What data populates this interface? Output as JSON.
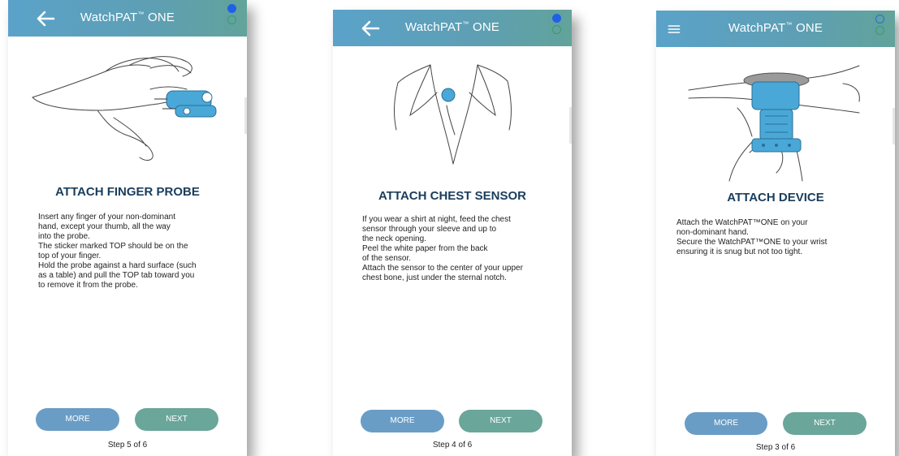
{
  "screens": [
    {
      "app_title": "WatchPAT",
      "app_title_tm": "™",
      "app_title_suffix": "ONE",
      "nav_icon": "back-arrow-icon",
      "heading": "ATTACH FINGER PROBE",
      "lines": [
        "Insert any finger of your non-dominant",
        "hand, except your thumb, all the way",
        "into the probe.",
        "The sticker marked TOP should be on the",
        "top of your finger.",
        "Hold the probe against a hard surface (such",
        "as a table) and pull the TOP tab toward you",
        "to remove it from the probe."
      ],
      "more_label": "MORE",
      "next_label": "NEXT",
      "step_label": "Step 5 of 6"
    },
    {
      "app_title": "WatchPAT",
      "app_title_tm": "™",
      "app_title_suffix": "ONE",
      "nav_icon": "back-arrow-icon",
      "heading": "ATTACH CHEST SENSOR",
      "lines": [
        "If you wear a shirt at night, feed the chest",
        "sensor through your sleeve and up to",
        "the neck opening.",
        "Peel the white paper from the back",
        "of the sensor.",
        "Attach the sensor to the center of your upper",
        "chest bone, just under the sternal notch."
      ],
      "more_label": "MORE",
      "next_label": "NEXT",
      "step_label": "Step 4 of 6"
    },
    {
      "app_title": "WatchPAT",
      "app_title_tm": "™",
      "app_title_suffix": "ONE",
      "nav_icon": "hamburger-menu-icon",
      "heading": "ATTACH DEVICE",
      "lines": [
        "Attach the WatchPAT™ONE on your",
        "non-dominant hand.",
        "Secure the WatchPAT™ONE to your wrist",
        "ensuring it is snug but not too tight."
      ],
      "more_label": "MORE",
      "next_label": "NEXT",
      "step_label": "Step 3 of 6"
    }
  ],
  "colors": {
    "appbar_blue": "#5aa2c9",
    "appbar_green": "#62a39b",
    "more_button": "#6a9dc5",
    "next_button": "#6aa69a",
    "heading": "#1a3d5c",
    "device_blue": "#4aa8d8"
  }
}
